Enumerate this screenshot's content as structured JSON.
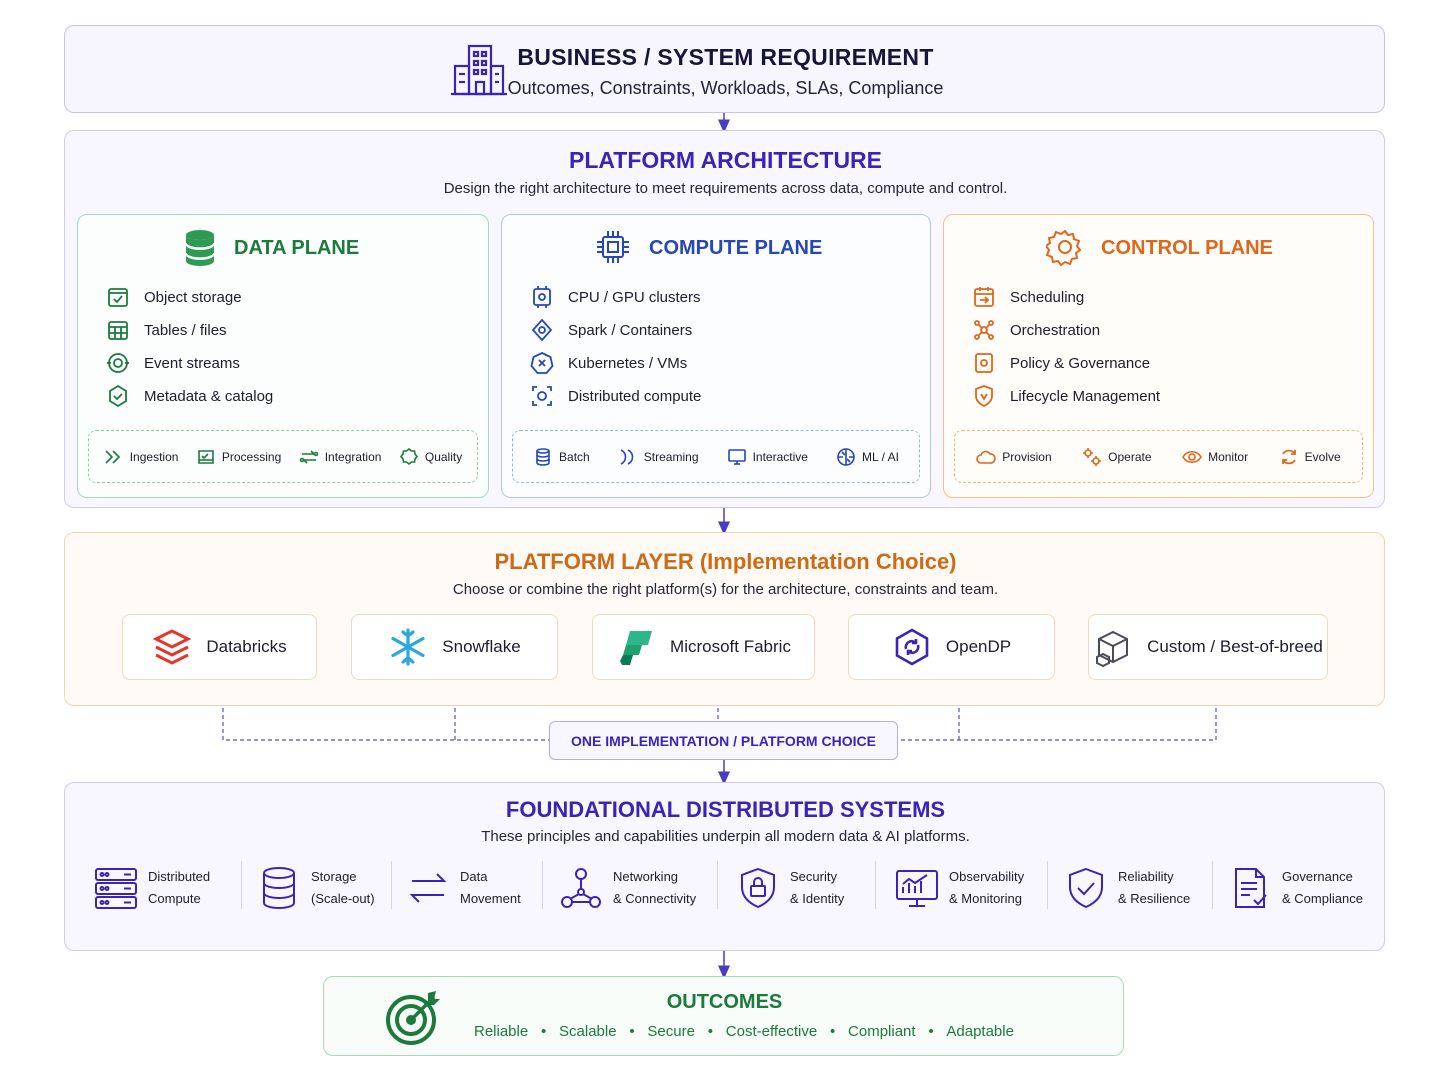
{
  "business": {
    "title": "BUSINESS / SYSTEM REQUIREMENT",
    "subtitle": "Outcomes, Constraints, Workloads, SLAs, Compliance",
    "icon": "building-icon"
  },
  "architecture": {
    "title": "PLATFORM ARCHITECTURE",
    "subtitle": "Design the right architecture to meet requirements across data, compute and control.",
    "data_plane": {
      "title": "DATA PLANE",
      "color": "#1c7a3c",
      "items": [
        "Object storage",
        "Tables / files",
        "Event streams",
        "Metadata & catalog"
      ],
      "chips": [
        "Ingestion",
        "Processing",
        "Integration",
        "Quality"
      ]
    },
    "compute_plane": {
      "title": "COMPUTE PLANE",
      "color": "#2746b8",
      "items": [
        "CPU / GPU clusters",
        "Spark / Containers",
        "Kubernetes / VMs",
        "Distributed compute"
      ],
      "chips": [
        "Batch",
        "Streaming",
        "Interactive",
        "ML / AI"
      ]
    },
    "control_plane": {
      "title": "CONTROL PLANE",
      "color": "#e0661a",
      "items": [
        "Scheduling",
        "Orchestration",
        "Policy & Governance",
        "Lifecycle Management"
      ],
      "chips": [
        "Provision",
        "Operate",
        "Monitor",
        "Evolve"
      ]
    }
  },
  "platform": {
    "title": "PLATFORM LAYER (Implementation Choice)",
    "subtitle": "Choose or combine the right platform(s) for the architecture, constraints and team.",
    "options": [
      "Databricks",
      "Snowflake",
      "Microsoft Fabric",
      "OpenDP",
      "Custom / Best-of-breed"
    ],
    "choice_label": "ONE IMPLEMENTATION / PLATFORM CHOICE"
  },
  "foundational": {
    "title": "FOUNDATIONAL DISTRIBUTED SYSTEMS",
    "subtitle": "These principles and capabilities underpin all modern data & AI platforms.",
    "items": [
      {
        "line1": "Distributed",
        "line2": "Compute"
      },
      {
        "line1": "Storage",
        "line2": "(Scale-out)"
      },
      {
        "line1": "Data",
        "line2": "Movement"
      },
      {
        "line1": "Networking",
        "line2": "& Connectivity"
      },
      {
        "line1": "Security",
        "line2": "& Identity"
      },
      {
        "line1": "Observability",
        "line2": "& Monitoring"
      },
      {
        "line1": "Reliability",
        "line2": "& Resilience"
      },
      {
        "line1": "Governance",
        "line2": "& Compliance"
      }
    ]
  },
  "outcomes": {
    "title": "OUTCOMES",
    "items": [
      "Reliable",
      "Scalable",
      "Secure",
      "Cost-effective",
      "Compliant",
      "Adaptable"
    ]
  },
  "colors": {
    "purple": "#3a24b8",
    "green": "#1c7a3c",
    "blue": "#2746b8",
    "orange": "#e0661a"
  }
}
